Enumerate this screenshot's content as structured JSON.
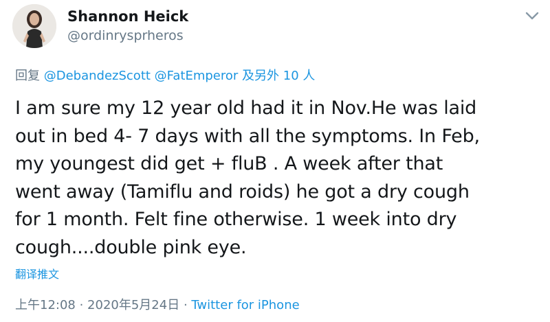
{
  "author": {
    "display_name": "Shannon Heick",
    "handle": "@ordinrysprheros"
  },
  "reply": {
    "prefix": "回复 ",
    "mention_1": "@DebandezScott",
    "mention_2": "@FatEmperor",
    "suffix": " 及另外 10 人"
  },
  "tweet": {
    "text": "I am sure my 12 year old had it in Nov.He was laid\nout in bed 4- 7 days with all the symptoms. In Feb,\nmy youngest did get + fluB . A week after that\nwent away (Tamiflu and roids) he got a dry cough\nfor 1 month. Felt fine otherwise. 1 week into dry\ncough....double pink eye."
  },
  "translate_label": "翻译推文",
  "meta": {
    "time": "上午12:08",
    "date": "2020年5月24日",
    "separator": " · ",
    "source": "Twitter for iPhone"
  },
  "colors": {
    "link": "#1b95e0",
    "secondary": "#657786",
    "text": "#14171a"
  },
  "icons": {
    "more": "chevron-down-icon"
  }
}
